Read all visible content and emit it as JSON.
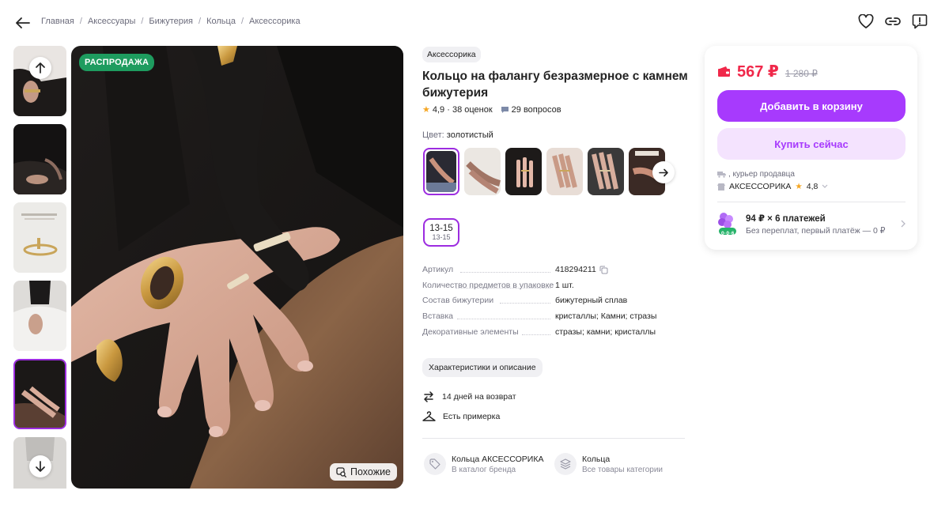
{
  "breadcrumb": [
    "Главная",
    "Аксессуары",
    "Бижутерия",
    "Кольца",
    "Аксессорика"
  ],
  "gallery": {
    "badge": "РАСПРОДАЖА",
    "similar_label": "Похожие"
  },
  "product": {
    "brand": "Аксессорика",
    "title": "Кольцо на фалангу безразмерное с камнем бижутерия",
    "rating": "4,9",
    "reviews": "38 оценок",
    "questions": "29 вопросов",
    "color_label": "Цвет:",
    "color_value": "золотистый",
    "size_main": "13-15",
    "size_sub": "13-15"
  },
  "specs": [
    {
      "key": "Артикул",
      "value": "418294211"
    },
    {
      "key": "Количество предметов в упаковке",
      "value": "1 шт."
    },
    {
      "key": "Состав бижутерии",
      "value": "бижутерный сплав"
    },
    {
      "key": "Вставка",
      "value": "кристаллы; Камни; стразы"
    },
    {
      "key": "Декоративные элементы",
      "value": "стразы; камни; кристаллы"
    }
  ],
  "characteristics_button": "Характеристики и описание",
  "features": {
    "return": "14 дней на возврат",
    "fitting": "Есть примерка"
  },
  "category_links": [
    {
      "title": "Кольца АКСЕССОРИКА",
      "subtitle": "В каталог бренда"
    },
    {
      "title": "Кольца",
      "subtitle": "Все товары категории"
    }
  ],
  "buybox": {
    "price": "567 ₽",
    "old_price": "1 280 ₽",
    "add_to_cart": "Добавить в корзину",
    "buy_now": "Купить сейчас",
    "delivery": ", курьер продавца",
    "seller_name": "АКСЕССОРИКА",
    "seller_rating": "4,8",
    "installment_title": "94 ₽ × 6 платежей",
    "installment_sub": "Без переплат, первый платёж — 0 ₽",
    "installment_badge": "0·0·6"
  },
  "colors": {
    "accent": "#a73afd",
    "price": "#f0284a",
    "sale": "#1e9c5f"
  }
}
